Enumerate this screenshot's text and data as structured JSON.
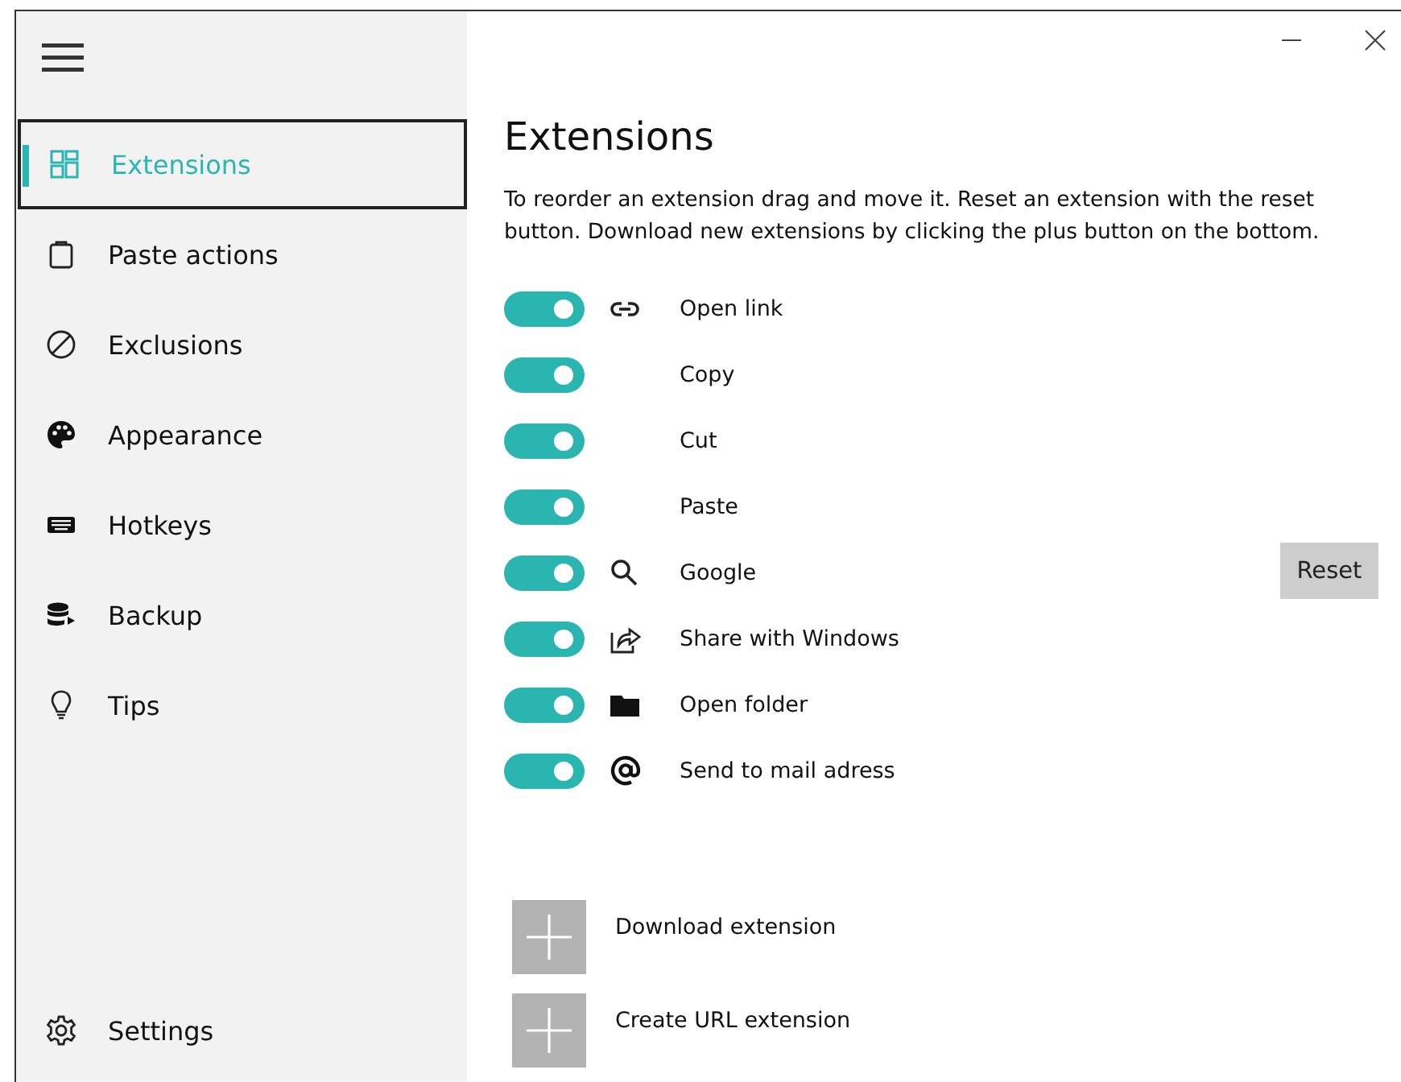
{
  "sidebar": {
    "items": [
      {
        "label": "Extensions",
        "kind": "extensions",
        "selected": true
      },
      {
        "label": "Paste actions",
        "kind": "clipboard",
        "selected": false
      },
      {
        "label": "Exclusions",
        "kind": "exclusions",
        "selected": false
      },
      {
        "label": "Appearance",
        "kind": "palette",
        "selected": false
      },
      {
        "label": "Hotkeys",
        "kind": "keyboard",
        "selected": false
      },
      {
        "label": "Backup",
        "kind": "backup",
        "selected": false
      },
      {
        "label": "Tips",
        "kind": "tips",
        "selected": false
      }
    ],
    "footer": {
      "label": "Settings",
      "kind": "settings",
      "selected": false
    }
  },
  "page": {
    "title": "Extensions",
    "description": "To reorder an extension drag and move it. Reset an extension with the reset button. Download new extensions by clicking the plus button on the bottom.",
    "extensions": [
      {
        "label": "Open link",
        "kind": "link",
        "on": true
      },
      {
        "label": "Copy",
        "kind": "plain",
        "on": true
      },
      {
        "label": "Cut",
        "kind": "plain",
        "on": true
      },
      {
        "label": "Paste",
        "kind": "plain",
        "on": true
      },
      {
        "label": "Google",
        "kind": "search",
        "on": true,
        "reset_button": "Reset"
      },
      {
        "label": "Share with Windows",
        "kind": "share",
        "on": true
      },
      {
        "label": "Open folder",
        "kind": "folder",
        "on": true
      },
      {
        "label": "Send to mail adress",
        "kind": "mail",
        "on": true
      }
    ],
    "add_buttons": [
      {
        "label": "Download extension"
      },
      {
        "label": "Create URL extension"
      }
    ]
  }
}
